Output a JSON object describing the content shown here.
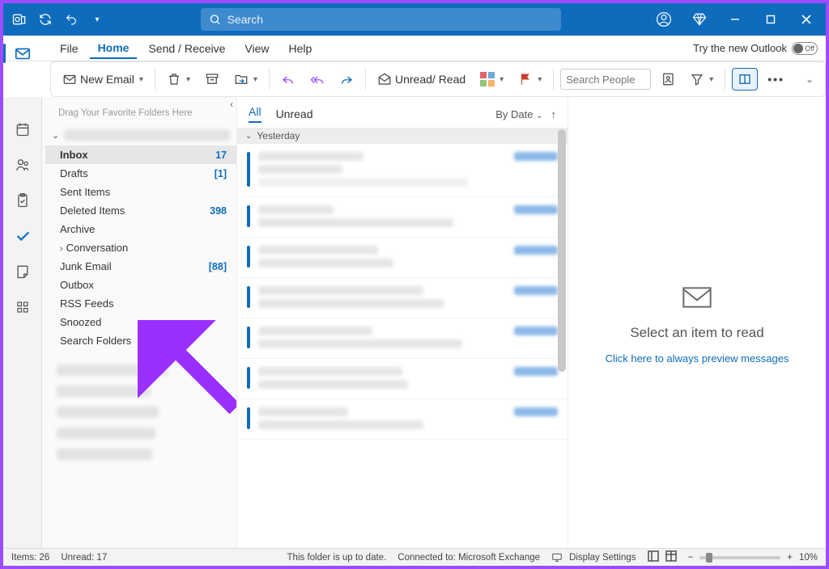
{
  "search": {
    "placeholder": "Search"
  },
  "menu": {
    "file": "File",
    "home": "Home",
    "sendreceive": "Send / Receive",
    "view": "View",
    "help": "Help"
  },
  "try_outlook": {
    "label": "Try the new Outlook",
    "state": "Off"
  },
  "ribbon": {
    "new_email": "New Email",
    "unread_read": "Unread/ Read",
    "search_people_ph": "Search People"
  },
  "folderpane": {
    "drag_hint": "Drag Your Favorite Folders Here",
    "folders": [
      {
        "name": "Inbox",
        "count": "17",
        "selected": true
      },
      {
        "name": "Drafts",
        "count": "[1]"
      },
      {
        "name": "Sent Items",
        "count": ""
      },
      {
        "name": "Deleted Items",
        "count": "398"
      },
      {
        "name": "Archive",
        "count": ""
      },
      {
        "name": "Conversation",
        "count": "",
        "expandable": true
      },
      {
        "name": "Junk Email",
        "count": "[88]"
      },
      {
        "name": "Outbox",
        "count": ""
      },
      {
        "name": "RSS Feeds",
        "count": ""
      },
      {
        "name": "Snoozed",
        "count": ""
      },
      {
        "name": "Search Folders",
        "count": ""
      }
    ]
  },
  "msgpane": {
    "tabs": {
      "all": "All",
      "unread": "Unread"
    },
    "sort": "By Date",
    "group": "Yesterday"
  },
  "readpane": {
    "title": "Select an item to read",
    "link": "Click here to always preview messages"
  },
  "status": {
    "items": "Items: 26",
    "unread": "Unread: 17",
    "folder_state": "This folder is up to date.",
    "connected": "Connected to: Microsoft Exchange",
    "display": "Display Settings",
    "zoom": "10%"
  }
}
